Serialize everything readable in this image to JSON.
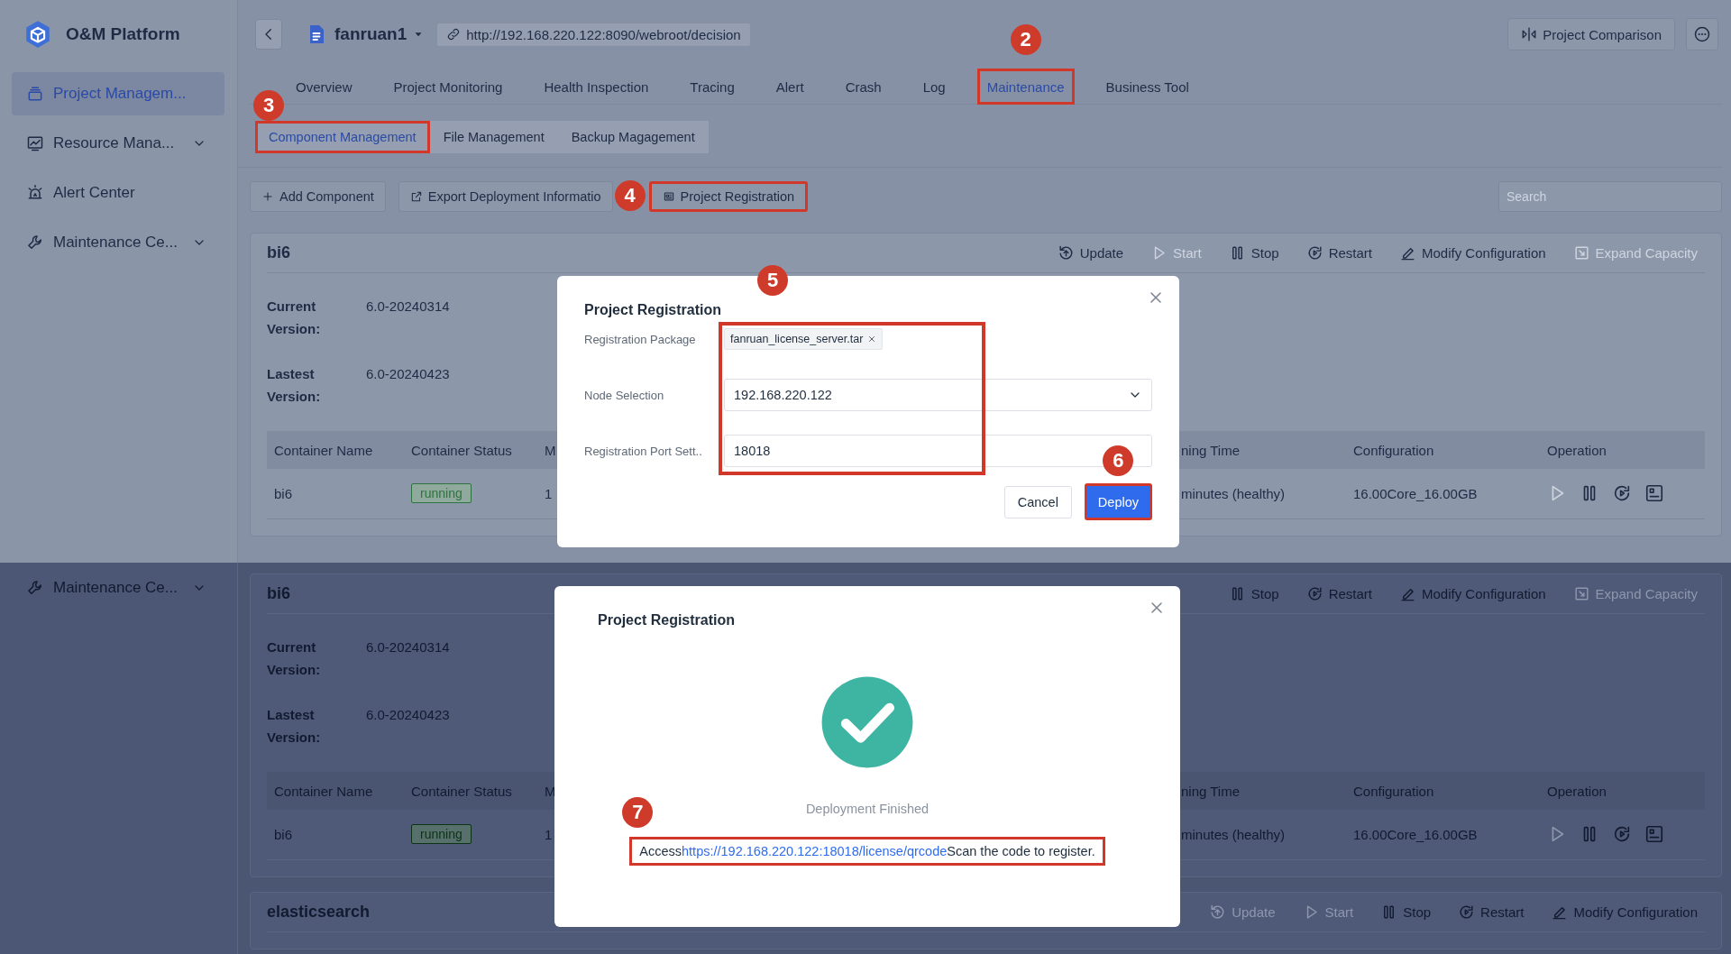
{
  "screens": [
    {
      "sidebar": {
        "title": "O&M Platform",
        "items": [
          {
            "label": "Project Managem...",
            "kind": "projects",
            "selected": true,
            "expandable": false
          },
          {
            "label": "Resource Mana...",
            "kind": "resources",
            "selected": false,
            "expandable": true
          },
          {
            "label": "Alert Center",
            "kind": "alerts",
            "selected": false,
            "expandable": false
          },
          {
            "label": "Maintenance Ce...",
            "kind": "maintenance",
            "selected": false,
            "expandable": true
          }
        ]
      },
      "header": {
        "project": "fanruan1",
        "url": "http://192.168.220.122:8090/webroot/decision",
        "compare_button": "Project Comparison"
      },
      "tabs": [
        {
          "label": "Overview",
          "selected": false
        },
        {
          "label": "Project Monitoring",
          "selected": false
        },
        {
          "label": "Health Inspection",
          "selected": false
        },
        {
          "label": "Tracing",
          "selected": false
        },
        {
          "label": "Alert",
          "selected": false
        },
        {
          "label": "Crash",
          "selected": false
        },
        {
          "label": "Log",
          "selected": false
        },
        {
          "label": "Maintenance",
          "selected": true,
          "annotation": "2"
        },
        {
          "label": "Business Tool",
          "selected": false
        }
      ],
      "subtabs": [
        {
          "label": "Component Management",
          "selected": true,
          "annotation": "3"
        },
        {
          "label": "File Management",
          "selected": false
        },
        {
          "label": "Backup Magagement",
          "selected": false
        }
      ],
      "toolbar": {
        "buttons": [
          {
            "kind": "add",
            "label": "Add Component"
          },
          {
            "kind": "export",
            "label": "Export Deployment Informatio"
          },
          {
            "kind": "register",
            "label": "Project Registration",
            "annotation": "4"
          }
        ],
        "search": {
          "placeholder": "Search"
        }
      },
      "cards": [
        {
          "name": "bi6",
          "actions": [
            {
              "kind": "update",
              "label": "Update",
              "disabled": false
            },
            {
              "kind": "start",
              "label": "Start",
              "disabled": true
            },
            {
              "kind": "stop",
              "label": "Stop",
              "disabled": false
            },
            {
              "kind": "restart",
              "label": "Restart",
              "disabled": false
            },
            {
              "kind": "modify",
              "label": "Modify Configuration",
              "disabled": false
            },
            {
              "kind": "expand",
              "label": "Expand Capacity",
              "disabled": true
            }
          ],
          "versions": [
            {
              "label": "Current Version:",
              "value": "6.0-20240314"
            },
            {
              "label": "Lastest Version:",
              "value": "6.0-20240423"
            }
          ],
          "table": {
            "columns": [
              "Container Name",
              "Container Status",
              "M",
              "ning Time",
              "Configuration",
              "Operation"
            ],
            "rows": [
              {
                "cells": [
                  "bi6",
                  "running",
                  "1",
                  "minutes (healthy)",
                  "16.00Core_16.00GB"
                ],
                "operations": [
                  {
                    "kind": "start",
                    "disabled": true
                  },
                  {
                    "kind": "stop",
                    "disabled": false
                  },
                  {
                    "kind": "restart",
                    "disabled": false
                  },
                  {
                    "kind": "console",
                    "disabled": false
                  }
                ]
              }
            ]
          }
        }
      ],
      "dialog": {
        "kind": "form",
        "title": "Project Registration",
        "fields_annotation": "5",
        "fields": [
          {
            "kind": "tags",
            "label": "Registration Package",
            "tags": [
              "fanruan_license_server.tar"
            ]
          },
          {
            "kind": "select",
            "label": "Node Selection",
            "value": "192.168.220.122"
          },
          {
            "kind": "input",
            "label": "Registration Port Sett..",
            "value": "18018"
          }
        ],
        "buttons": [
          {
            "label": "Cancel",
            "primary": false
          },
          {
            "label": "Deploy",
            "primary": true,
            "annotation": "6"
          }
        ]
      }
    },
    {
      "sidebar": {
        "items": [
          {
            "label": "Maintenance Ce...",
            "kind": "maintenance",
            "selected": false,
            "expandable": true
          }
        ]
      },
      "cards": [
        {
          "name": "bi6",
          "actions": [
            {
              "kind": "stop",
              "label": "Stop",
              "disabled": false
            },
            {
              "kind": "restart",
              "label": "Restart",
              "disabled": false
            },
            {
              "kind": "modify",
              "label": "Modify Configuration",
              "disabled": false
            },
            {
              "kind": "expand",
              "label": "Expand Capacity",
              "disabled": true
            }
          ],
          "versions": [
            {
              "label": "Current Version:",
              "value": "6.0-20240314"
            },
            {
              "label": "Lastest Version:",
              "value": "6.0-20240423"
            }
          ],
          "table": {
            "columns": [
              "Container Name",
              "Container Status",
              "M",
              "ning Time",
              "Configuration",
              "Operation"
            ],
            "rows": [
              {
                "cells": [
                  "bi6",
                  "running",
                  "1",
                  "minutes (healthy)",
                  "16.00Core_16.00GB"
                ],
                "operations": [
                  {
                    "kind": "start",
                    "disabled": true
                  },
                  {
                    "kind": "stop",
                    "disabled": false
                  },
                  {
                    "kind": "restart",
                    "disabled": false
                  },
                  {
                    "kind": "console",
                    "disabled": false
                  }
                ]
              }
            ]
          }
        },
        {
          "name": "elasticsearch",
          "actions": [
            {
              "kind": "update",
              "label": "Update",
              "disabled": true
            },
            {
              "kind": "start",
              "label": "Start",
              "disabled": true
            },
            {
              "kind": "stop",
              "label": "Stop",
              "disabled": false
            },
            {
              "kind": "restart",
              "label": "Restart",
              "disabled": false
            },
            {
              "kind": "modify",
              "label": "Modify Configuration",
              "disabled": false
            }
          ]
        }
      ],
      "dialog": {
        "kind": "success",
        "title": "Project Registration",
        "status": "Deployment Finished",
        "message": {
          "before": "Access",
          "link": "https://192.168.220.122:18018/license/qrcode",
          "after": "Scan the code to register.",
          "annotation": "7"
        }
      }
    }
  ]
}
